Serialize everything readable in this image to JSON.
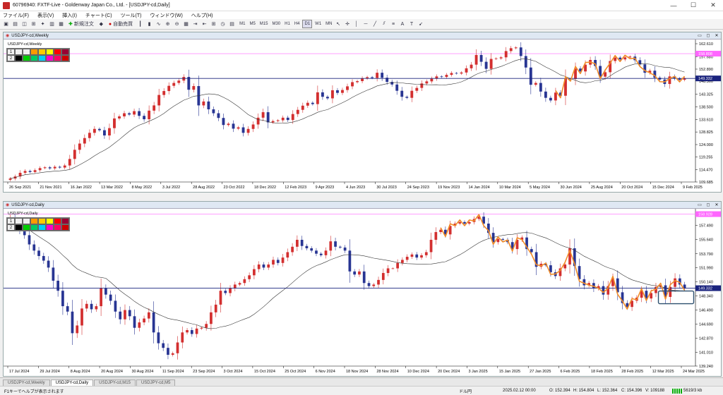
{
  "window": {
    "title": "60796940: FXTF-Live - Goldenway Japan Co., Ltd. - [USDJPY-cd,Daily]",
    "minimize": "—",
    "maximize": "☐",
    "close": "✕"
  },
  "menu": [
    "ファイル(F)",
    "表示(V)",
    "挿入(I)",
    "チャート(C)",
    "ツール(T)",
    "ウィンドウ(W)",
    "ヘルプ(H)"
  ],
  "toolbar": {
    "new_order": "新規注文",
    "auto_trade": "自動売買",
    "timeframes": [
      "M1",
      "M5",
      "M15",
      "M30",
      "H1",
      "H4",
      "D1",
      "W1",
      "MN"
    ],
    "selected_timeframe": "D1"
  },
  "palette": {
    "row1_label": "1",
    "row2_label": "2",
    "row1_colors": [
      "#f0f0f0",
      "#f0f0f0",
      "#f0f0f0",
      "#ff9900",
      "#ffcc00",
      "#ffff00",
      "#ff0000",
      "#990033"
    ],
    "row2_colors": [
      "#f0f0f0",
      "#000000",
      "#00cc00",
      "#00cc66",
      "#00ccff",
      "#ff00cc",
      "#ff0066",
      "#cc0000"
    ]
  },
  "weekly_chart": {
    "window_title": "USDJPY-cd,Weekly",
    "label": "USDJPY-cd,Weekly",
    "price_labels": [
      "162.610",
      "157.680",
      "152.890",
      "148.360",
      "143.325",
      "138.500",
      "133.610",
      "128.825",
      "124.000",
      "119.255",
      "114.470",
      "109.685"
    ],
    "price_range": [
      109.685,
      162.61
    ],
    "current_price": "149.332",
    "marker_price": "158.808",
    "date_labels": [
      "26 Sep 2021",
      "21 Nov 2021",
      "16 Jan 2022",
      "13 Mar 2022",
      "8 May 2022",
      "3 Jul 2022",
      "28 Aug 2022",
      "23 Oct 2022",
      "18 Dec 2022",
      "12 Feb 2023",
      "9 Apr 2023",
      "4 Jun 2023",
      "30 Jul 2023",
      "24 Sep 2023",
      "19 Nov 2023",
      "14 Jan 2024",
      "10 Mar 2024",
      "5 May 2024",
      "30 Jun 2024",
      "25 Aug 2024",
      "20 Oct 2024",
      "15 Dec 2024",
      "9 Feb 2025"
    ]
  },
  "daily_chart": {
    "window_title": "USDJPY-cd,Daily",
    "label": "USDJPY-cd,Daily",
    "price_labels": [
      "159.070",
      "157.490",
      "155.640",
      "153.790",
      "151.990",
      "150.140",
      "148.340",
      "146.490",
      "144.690",
      "142.870",
      "141.010",
      "139.240"
    ],
    "price_range": [
      139.24,
      159.07
    ],
    "current_price": "149.332",
    "marker_price": "158.928",
    "date_labels": [
      "17 Jul 2024",
      "29 Jul 2024",
      "8 Aug 2024",
      "20 Aug 2024",
      "30 Aug 2024",
      "11 Sep 2024",
      "23 Sep 2024",
      "3 Oct 2024",
      "15 Oct 2024",
      "25 Oct 2024",
      "6 Nov 2024",
      "18 Nov 2024",
      "28 Nov 2024",
      "10 Dec 2024",
      "20 Dec 2024",
      "3 Jan 2025",
      "15 Jan 2025",
      "27 Jan 2025",
      "6 Feb 2025",
      "18 Feb 2025",
      "28 Feb 2025",
      "12 Mar 2025",
      "24 Mar 2025"
    ]
  },
  "chart_data": [
    {
      "type": "candlestick",
      "title": "USDJPY-cd,Weekly",
      "ylim": [
        109.685,
        162.61
      ],
      "x_range": [
        "26 Sep 2021",
        "24 Mar 2025"
      ],
      "closes": [
        111.0,
        111.8,
        113.2,
        113.9,
        113.5,
        114.2,
        115.0,
        115.3,
        114.9,
        115.5,
        115.2,
        116.0,
        118.5,
        122.0,
        124.4,
        126.5,
        128.5,
        130.0,
        129.5,
        127.5,
        130.3,
        134.0,
        134.8,
        136.0,
        135.5,
        136.8,
        135.0,
        133.7,
        137.0,
        139.0,
        143.0,
        144.5,
        146.5,
        147.6,
        148.5,
        149.9,
        145.0,
        146.4,
        139.0,
        140.5,
        137.5,
        136.0,
        134.2,
        131.5,
        132.0,
        130.1,
        130.6,
        128.5,
        130.0,
        131.7,
        134.3,
        136.4,
        132.5,
        133.0,
        133.3,
        134.3,
        133.4,
        135.7,
        137.3,
        138.9,
        140.0,
        139.5,
        144.0,
        142.3,
        141.7,
        144.8,
        143.8,
        144.9,
        146.3,
        147.9,
        148.3,
        149.3,
        149.8,
        149.5,
        151.5,
        149.6,
        148.0,
        147.0,
        144.6,
        142.3,
        141.9,
        144.6,
        145.7,
        147.4,
        148.2,
        149.2,
        150.1,
        149.9,
        150.7,
        151.4,
        151.2,
        151.6,
        153.2,
        154.6,
        158.3,
        155.7,
        153.0,
        156.8,
        157.0,
        157.4,
        159.8,
        160.9,
        161.2,
        157.9,
        153.5,
        146.9,
        147.6,
        144.3,
        141.9,
        140.9,
        143.9,
        142.7,
        149.2,
        149.1,
        153.1,
        152.0,
        154.6,
        156.4,
        154.1,
        150.0,
        151.7,
        156.0,
        157.3,
        156.6,
        157.4,
        157.7,
        156.3,
        154.7,
        151.5,
        152.3,
        149.6,
        148.9,
        147.2,
        150.1,
        149.3,
        148.8,
        149.33
      ]
    },
    {
      "type": "candlestick",
      "title": "USDJPY-cd,Daily",
      "ylim": [
        139.24,
        159.07
      ],
      "x_range": [
        "17 Jul 2024",
        "28 Mar 2025"
      ],
      "closes": [
        158.5,
        157.8,
        156.9,
        156.2,
        155.0,
        154.2,
        153.5,
        152.9,
        152.0,
        150.3,
        149.0,
        147.0,
        146.3,
        143.5,
        144.5,
        146.7,
        147.3,
        146.6,
        147.0,
        149.3,
        148.5,
        147.7,
        146.3,
        145.3,
        146.5,
        145.7,
        144.2,
        144.9,
        145.4,
        146.2,
        143.6,
        142.2,
        141.6,
        140.7,
        140.9,
        142.3,
        143.6,
        143.9,
        143.4,
        144.1,
        144.2,
        144.7,
        146.2,
        147.2,
        149.0,
        148.7,
        149.3,
        149.8,
        150.0,
        150.5,
        151.0,
        151.8,
        152.4,
        152.0,
        152.4,
        153.0,
        152.6,
        153.3,
        154.0,
        154.7,
        155.6,
        154.8,
        154.5,
        154.2,
        153.8,
        153.6,
        154.2,
        155.4,
        154.7,
        154.6,
        154.2,
        151.5,
        151.1,
        151.5,
        150.0,
        149.6,
        149.8,
        150.4,
        151.3,
        151.9,
        151.9,
        152.6,
        153.0,
        153.4,
        153.7,
        153.3,
        153.6,
        154.0,
        155.6,
        156.6,
        156.9,
        156.3,
        157.4,
        157.7,
        157.9,
        157.7,
        157.9,
        158.3,
        158.6,
        157.7,
        156.5,
        155.3,
        155.7,
        155.6,
        155.3,
        154.4,
        155.6,
        155.9,
        154.4,
        154.0,
        152.1,
        152.5,
        152.3,
        151.4,
        150.9,
        151.9,
        152.4,
        154.5,
        152.2,
        150.5,
        149.7,
        150.0,
        149.3,
        149.6,
        148.5,
        149.6,
        150.6,
        148.8,
        147.4,
        146.9,
        147.7,
        148.1,
        149.0,
        148.0,
        148.7,
        149.5,
        149.7,
        148.2,
        149.5,
        150.6,
        149.8,
        149.33
      ]
    }
  ],
  "tabs": [
    "USDJPY-cd,Weekly",
    "USDJPY-cd,Daily",
    "USDJPY-cd,M15",
    "USDJPY-cd,M5"
  ],
  "active_tab": "USDJPY-cd,Daily",
  "status": {
    "help": "F1キーでヘルプが表示されます",
    "profile": "ドル円",
    "time": "2025.02.12 00:00",
    "open": "O: 152.394",
    "high": "H: 154.804",
    "low": "L: 152.364",
    "close": "C: 154.396",
    "volume": "V: 109188",
    "traffic": "5619/3 kb"
  }
}
